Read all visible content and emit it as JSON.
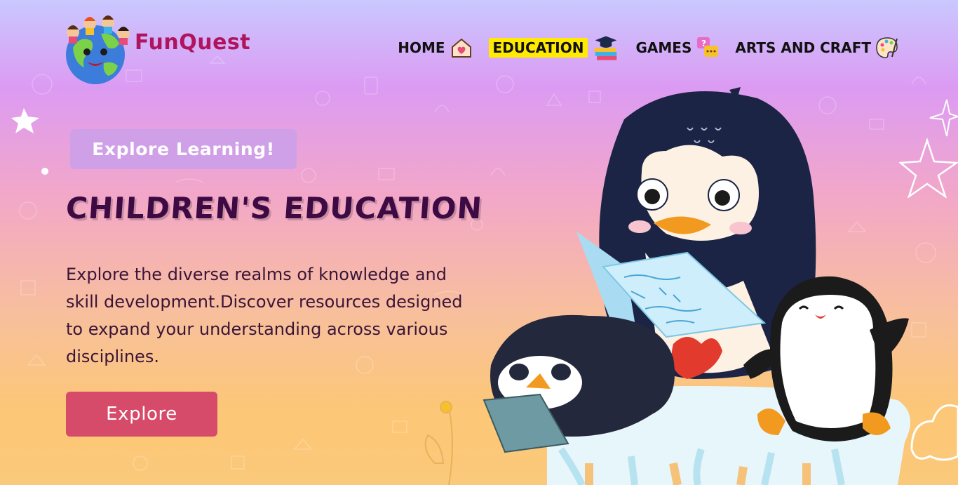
{
  "brand": {
    "name_part1": "Fun",
    "name_part2": "Quest"
  },
  "nav": {
    "items": [
      {
        "label": "HOME",
        "icon": "home-heart-icon"
      },
      {
        "label": "EDUCATION",
        "icon": "graduation-books-icon",
        "active": true
      },
      {
        "label": "GAMES",
        "icon": "chat-bubbles-icon"
      },
      {
        "label": "ARTS AND CRAFT",
        "icon": "palette-icon"
      }
    ]
  },
  "hero": {
    "badge": "Explore Learning!",
    "title": "CHILDREN'S EDUCATION",
    "description": "Explore the diverse realms of knowledge and skill development.Discover resources designed to expand your understanding across various disciplines.",
    "button": "Explore"
  },
  "colors": {
    "brand": "#b0145e",
    "title": "#3d0a44",
    "button": "#d64b6a",
    "badge": "#cfa0e8",
    "active_nav_highlight": "#ffea00"
  }
}
